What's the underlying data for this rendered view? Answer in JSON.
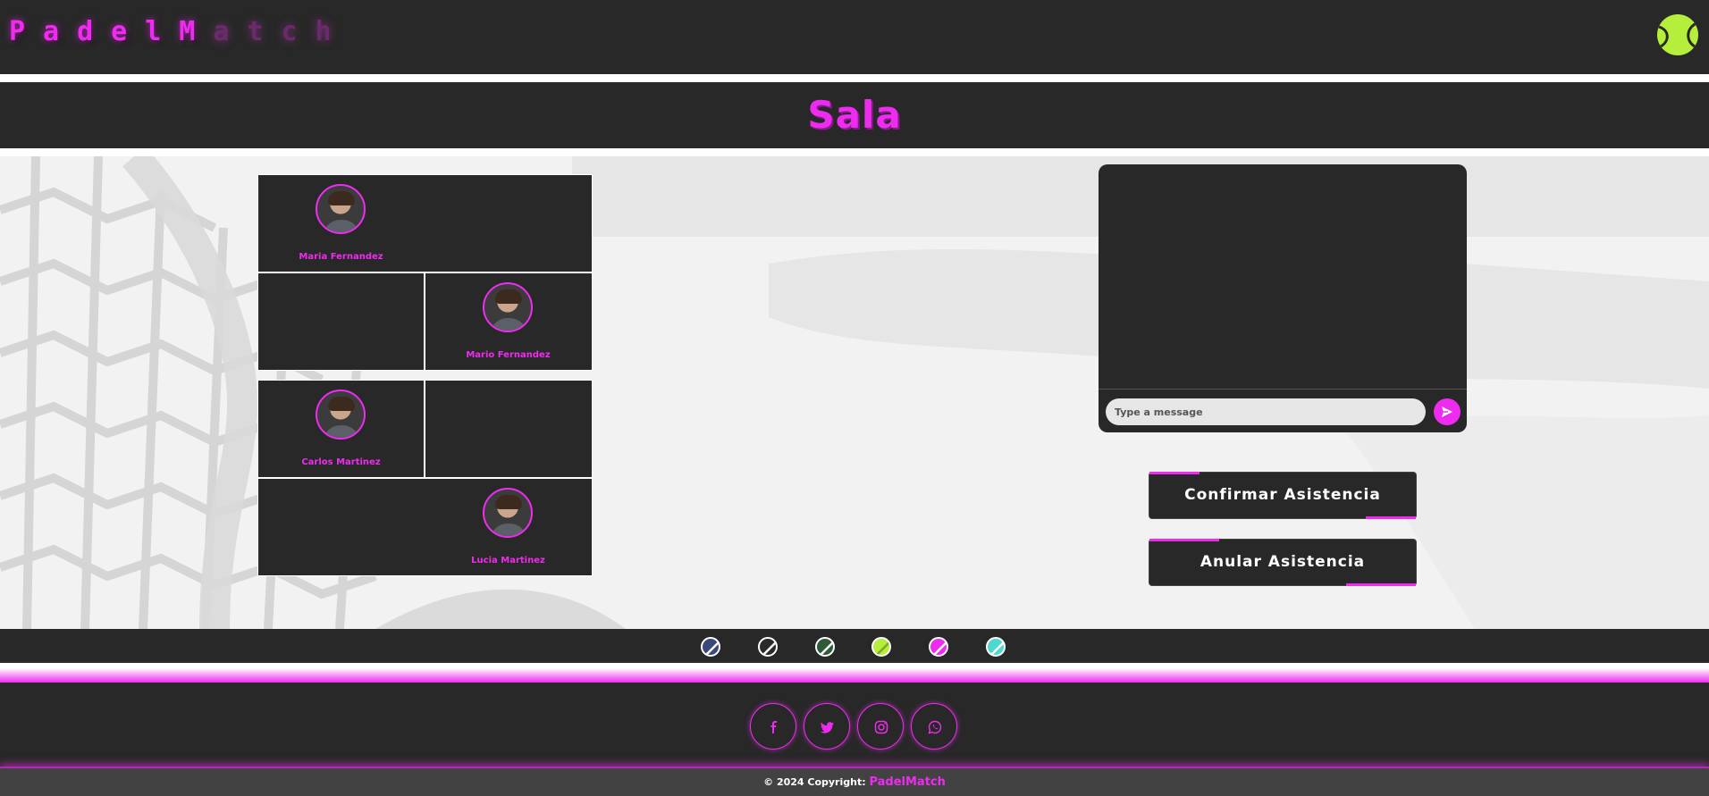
{
  "header": {
    "logo_strong": "PadelM",
    "logo_fade": "atch",
    "ball_icon": "tennis-ball-icon"
  },
  "page": {
    "title": "Sala"
  },
  "players": [
    {
      "name": "Maria Fernandez"
    },
    {
      "name": "Mario Fernandez"
    },
    {
      "name": "Carlos Martinez"
    },
    {
      "name": "Lucia Martinez"
    }
  ],
  "chat": {
    "placeholder": "Type a message",
    "send_icon": "send-icon"
  },
  "actions": {
    "confirm_label": "Confirmar Asistencia",
    "cancel_label": "Anular Asistencia"
  },
  "ball_strip": {
    "balls": [
      {
        "color": "#3a4a78",
        "icon": "ball-icon"
      },
      {
        "color": "#2a2a2a",
        "icon": "ball-icon"
      },
      {
        "color": "#2f5a3a",
        "icon": "ball-icon"
      },
      {
        "color": "#b6ef3b",
        "icon": "ball-icon"
      },
      {
        "color": "#ee2cf0",
        "icon": "ball-icon"
      },
      {
        "color": "#4fd8d0",
        "icon": "ball-icon"
      }
    ]
  },
  "footer": {
    "social": [
      {
        "icon": "facebook-icon"
      },
      {
        "icon": "twitter-icon"
      },
      {
        "icon": "instagram-icon"
      },
      {
        "icon": "whatsapp-icon"
      }
    ],
    "copyright_prefix": "© 2024 Copyright:",
    "copyright_brand": "PadelMatch"
  },
  "colors": {
    "accent": "#ee2cf0",
    "dark": "#282828",
    "ball": "#b6ef3b"
  }
}
